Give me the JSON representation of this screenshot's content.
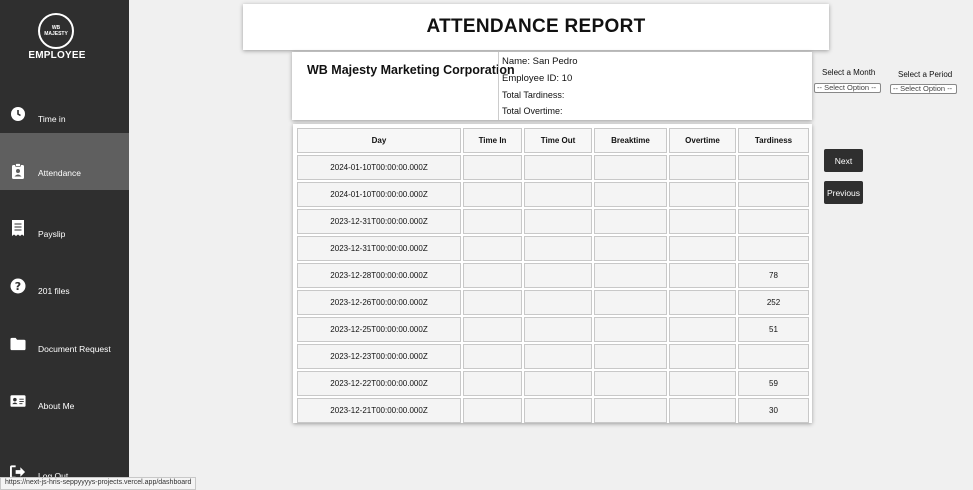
{
  "sidebar": {
    "logo_text": "WB MAJESTY",
    "brand": "EMPLOYEE",
    "items": [
      {
        "label": "Time in",
        "icon": "clock-icon"
      },
      {
        "label": "Attendance",
        "icon": "clipboard-user-icon",
        "active": true
      },
      {
        "label": "Payslip",
        "icon": "receipt-icon"
      },
      {
        "label": "201 files",
        "icon": "question-circle-icon"
      },
      {
        "label": "Document Request",
        "icon": "folder-icon"
      },
      {
        "label": "About Me",
        "icon": "id-card-icon"
      },
      {
        "label": "Log Out",
        "icon": "sign-out-icon"
      }
    ]
  },
  "header": {
    "title": "ATTENDANCE REPORT"
  },
  "info": {
    "company": "WB Majesty Marketing Corporation",
    "name": "Name: San Pedro",
    "employee_id": "Employee ID: 10",
    "total_tardiness": "Total Tardiness:",
    "total_overtime": "Total Overtime:"
  },
  "filters": {
    "month_label": "Select a Month",
    "month_value": "-- Select Option --",
    "period_label": "Select a Period",
    "period_value": "-- Select Option --"
  },
  "table": {
    "headers": [
      "Day",
      "Time In",
      "Time Out",
      "Breaktime",
      "Overtime",
      "Tardiness"
    ],
    "rows": [
      [
        "2024-01-10T00:00:00.000Z",
        "",
        "",
        "",
        "",
        ""
      ],
      [
        "2024-01-10T00:00:00.000Z",
        "",
        "",
        "",
        "",
        ""
      ],
      [
        "2023-12-31T00:00:00.000Z",
        "",
        "",
        "",
        "",
        ""
      ],
      [
        "2023-12-31T00:00:00.000Z",
        "",
        "",
        "",
        "",
        ""
      ],
      [
        "2023-12-28T00:00:00.000Z",
        "",
        "",
        "",
        "",
        "78"
      ],
      [
        "2023-12-26T00:00:00.000Z",
        "",
        "",
        "",
        "",
        "252"
      ],
      [
        "2023-12-25T00:00:00.000Z",
        "",
        "",
        "",
        "",
        "51"
      ],
      [
        "2023-12-23T00:00:00.000Z",
        "",
        "",
        "",
        "",
        ""
      ],
      [
        "2023-12-22T00:00:00.000Z",
        "",
        "",
        "",
        "",
        "59"
      ],
      [
        "2023-12-21T00:00:00.000Z",
        "",
        "",
        "",
        "",
        "30"
      ]
    ]
  },
  "buttons": {
    "next": "Next",
    "previous": "Previous"
  },
  "status_bar": {
    "url": "https://next-js-hris-seppyyyys-projects.vercel.app/dashboard"
  }
}
